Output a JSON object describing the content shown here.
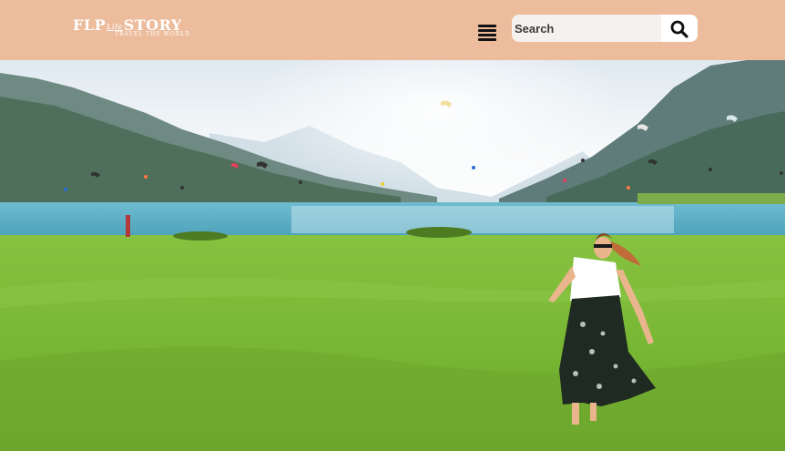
{
  "header": {
    "logo": {
      "main_left": "FLP",
      "main_mid": "Life",
      "main_right": "STORY",
      "tagline": "TRAVEL THE WORLD"
    },
    "menu_icon": "hamburger-menu-icon",
    "search": {
      "placeholder": "Search",
      "value": "",
      "icon": "search-icon"
    }
  },
  "colors": {
    "header_bg": "#ecbc9c",
    "sky": "#eaf2f6",
    "lake": "#5fb2c9",
    "grass": "#79b833"
  },
  "hero": {
    "scene": "kite-lake-meadow-photo"
  }
}
